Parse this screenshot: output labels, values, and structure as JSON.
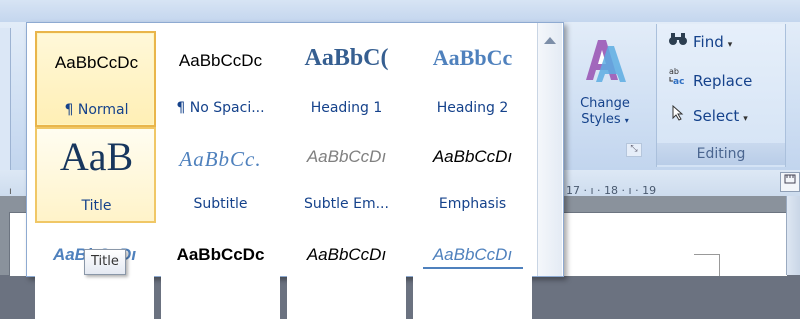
{
  "gallery": {
    "styles": [
      {
        "sample": "AaBbCcDc",
        "label": "¶ Normal"
      },
      {
        "sample": "AaBbCcDc",
        "label": "¶ No Spaci..."
      },
      {
        "sample": "AaBbC(",
        "label": "Heading 1"
      },
      {
        "sample": "AaBbCc",
        "label": "Heading 2"
      },
      {
        "sample": "AaB",
        "label": "Title"
      },
      {
        "sample": "AaBbCc.",
        "label": "Subtitle"
      },
      {
        "sample": "AaBbCcDı",
        "label": "Subtle Em..."
      },
      {
        "sample": "AaBbCcDı",
        "label": "Emphasis"
      },
      {
        "sample": "AaBbCcDı",
        "label": ""
      },
      {
        "sample": "AaBbCcDc",
        "label": ""
      },
      {
        "sample": "AaBbCcDı",
        "label": ""
      },
      {
        "sample": "AaBbCcDı",
        "label": ""
      }
    ]
  },
  "tooltip": {
    "text": "Title"
  },
  "change_styles": {
    "label_line1": "Change",
    "label_line2": "Styles",
    "caret": "▾"
  },
  "editing": {
    "find_label": "Find",
    "replace_label": "Replace",
    "select_label": "Select",
    "caret": "▾",
    "group_title": "Editing"
  },
  "ruler": {
    "text": "17 · ı · 18 · ı · 19",
    "left_tick": "ı"
  },
  "icons": {
    "find": "binoculars-icon",
    "replace": "replace-icon",
    "select": "cursor-icon",
    "change_styles": "change-styles-icon",
    "launcher": "dialog-launcher-icon",
    "scroll_up": "scroll-up-arrow-icon"
  }
}
